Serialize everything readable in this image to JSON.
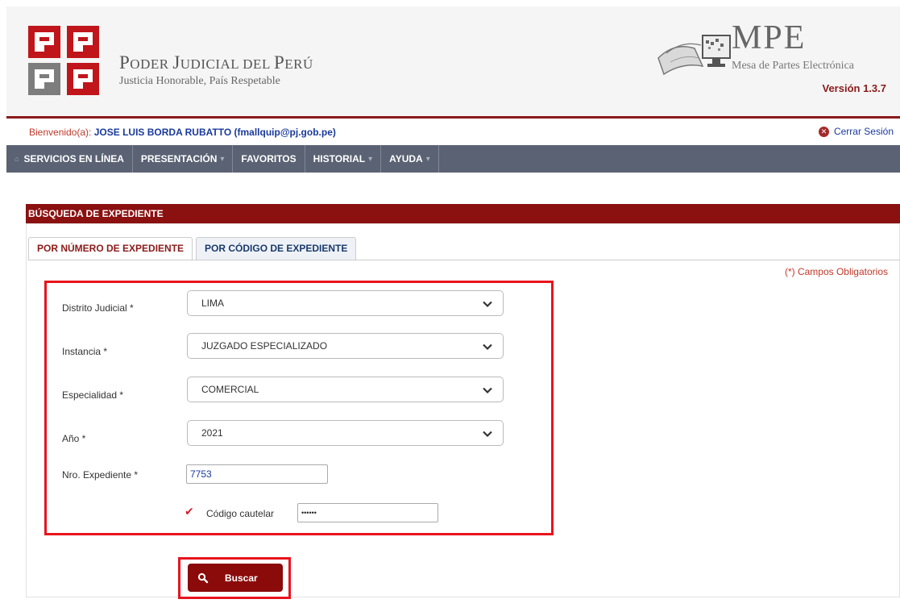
{
  "header": {
    "brand_title_p1": "P",
    "brand_title_p2": "ODER ",
    "brand_title_p3": "J",
    "brand_title_p4": "UDICIAL DEL ",
    "brand_title_p5": "P",
    "brand_title_p6": "ERÚ",
    "brand_subtitle": "Justicia Honorable, País Respetable",
    "app_title": "MPE",
    "app_subtitle": "Mesa de Partes Electrónica",
    "version": "Versión 1.3.7"
  },
  "welcome": {
    "prefix": "Bienvenido(a): ",
    "user": "JOSE LUIS BORDA RUBATTO (fmallquip@pj.gob.pe)",
    "logout_label": "Cerrar Sesión"
  },
  "menu": {
    "items": [
      {
        "label": "SERVICIOS EN LÍNEA",
        "icon": "home-icon"
      },
      {
        "label": "PRESENTACIÓN",
        "caret": "▾"
      },
      {
        "label": "FAVORITOS"
      },
      {
        "label": "HISTORIAL",
        "caret": "▾"
      },
      {
        "label": "AYUDA",
        "caret": "▾"
      }
    ]
  },
  "section": {
    "title": "BÚSQUEDA DE EXPEDIENTE",
    "tabs": [
      "POR NÚMERO DE EXPEDIENTE",
      "POR CÓDIGO DE EXPEDIENTE"
    ],
    "required_note": "(*) Campos Obligatorios"
  },
  "form": {
    "distrito_label": "Distrito Judicial *",
    "distrito_value": "LIMA",
    "instancia_label": "Instancia *",
    "instancia_value": "JUZGADO ESPECIALIZADO",
    "especialidad_label": "Especialidad *",
    "especialidad_value": "COMERCIAL",
    "anio_label": "Año *",
    "anio_value": "2021",
    "nro_label": "Nro. Expediente *",
    "nro_value": "7753",
    "codigo_label": "Código cautelar",
    "codigo_value": "••••••",
    "codigo_checked": true
  },
  "actions": {
    "search_label": "Buscar"
  },
  "colors": {
    "brand_red": "#8b1010",
    "menu_bg": "#5a6273",
    "highlight": "#e8141e",
    "link_blue": "#1a3a9c"
  }
}
